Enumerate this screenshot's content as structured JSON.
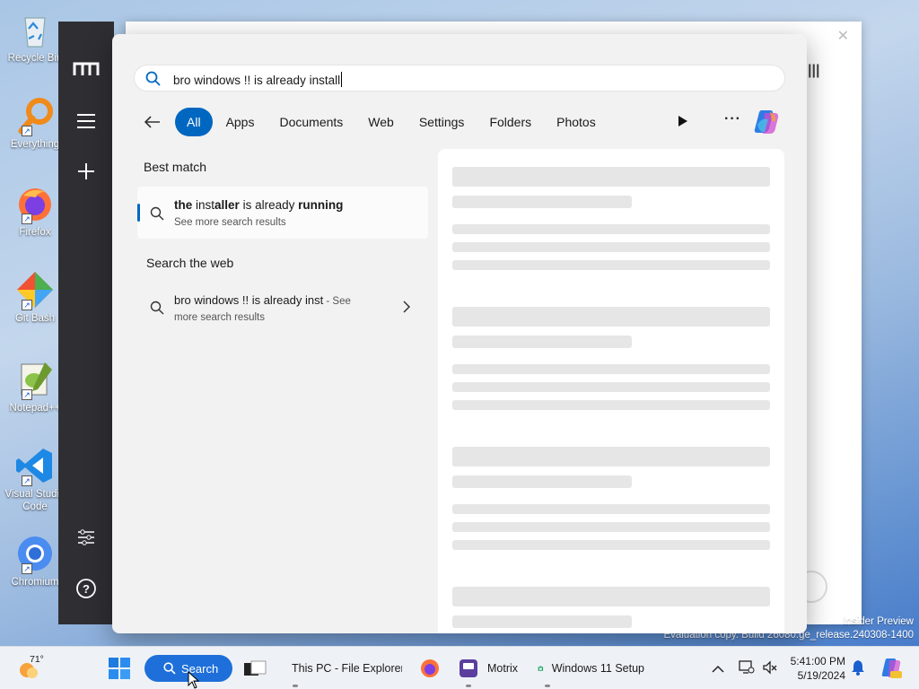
{
  "desktop": {
    "icons": [
      {
        "label": "Recycle Bin",
        "label2": ""
      },
      {
        "label": "Everything",
        "label2": ""
      },
      {
        "label": "Firefox",
        "label2": ""
      },
      {
        "label": "Git Bash",
        "label2": ""
      },
      {
        "label": "Notepad++",
        "label2": ""
      },
      {
        "label": "Visual Studio",
        "label2": "Code"
      },
      {
        "label": "Chromium",
        "label2": ""
      }
    ],
    "watermark_line1": "Insider Preview",
    "watermark_line2": "Evaluation copy. Build 26080.ge_release.240308-1400"
  },
  "search": {
    "query": "bro windows !! is already install",
    "filters": [
      "All",
      "Apps",
      "Documents",
      "Web",
      "Settings",
      "Folders",
      "Photos"
    ],
    "active_filter": "All",
    "best_match_heading": "Best match",
    "best_match": {
      "title_parts": [
        {
          "text": "the ",
          "bold": true
        },
        {
          "text": "inst",
          "bold": false
        },
        {
          "text": "aller",
          "bold": true
        },
        {
          "text": " is already ",
          "bold": false
        },
        {
          "text": "running",
          "bold": true
        }
      ],
      "subtitle": "See more search results"
    },
    "web_heading": "Search the web",
    "web_result": {
      "title": "bro windows !! is already inst",
      "suffix": " - See",
      "subtitle": "more search results"
    }
  },
  "taskbar": {
    "weather_temp": "71°",
    "search_label": "Search",
    "apps": [
      {
        "label": "This PC - File Explorer"
      },
      {
        "label": "Motrix"
      },
      {
        "label": "Windows 11 Setup"
      }
    ],
    "time": "5:41:00 PM",
    "date": "5/19/2024"
  },
  "colors": {
    "accent": "#0067c0",
    "taskbar_search": "#1e6fd9",
    "motrix_sidebar": "#2f2f33"
  }
}
